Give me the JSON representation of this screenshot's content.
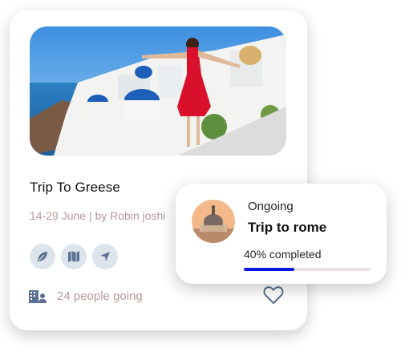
{
  "card": {
    "title": "Trip To Greese",
    "subtitle": "14-29 June | by Robin joshi",
    "icons": [
      "leaf-icon",
      "map-icon",
      "navigation-icon"
    ],
    "people_icon": "buildings-people-icon",
    "people_text": "24 people going",
    "favorite_icon": "heart-icon"
  },
  "popup": {
    "status": "Ongoing",
    "title": "Trip to rome",
    "progress_label": "40% completed",
    "progress": 0.4
  },
  "colors": {
    "accent": "#0716e0",
    "muted_text": "#b89898",
    "icon_bg": "#dde4ec",
    "icon_fg": "#5a7192"
  }
}
